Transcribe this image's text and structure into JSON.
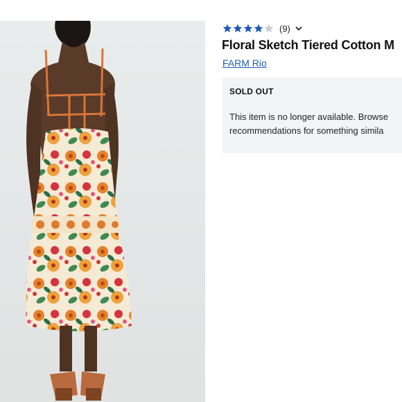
{
  "product": {
    "rating": {
      "stars_filled": 4,
      "stars_total": 5,
      "review_count": "(9)"
    },
    "title": "Floral Sketch Tiered Cotton M",
    "brand": "FARM Rio",
    "status": {
      "label": "SOLD OUT",
      "message": "This item is no longer available. Browse\nrecommendations for something simila"
    }
  },
  "colors": {
    "star": "#1c5bb7",
    "star_empty": "#c9cdd2",
    "brand_link": "#1c5bb7",
    "panel_bg": "#f3f4f5"
  }
}
